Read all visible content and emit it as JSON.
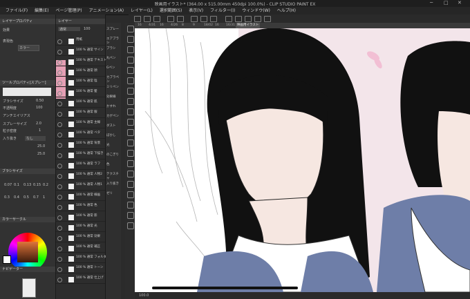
{
  "app": {
    "title": "映画用イラスト* (364.00 x 515.00mm 450dpi 100.0%) - CLIP STUDIO PAINT EX",
    "menu": [
      "ファイル(F)",
      "編集(E)",
      "ページ管理(P)",
      "アニメーション(A)",
      "レイヤー(L)",
      "選択範囲(S)",
      "表示(V)",
      "フィルター(I)",
      "ウィンドウ(W)",
      "ヘルプ(H)"
    ]
  },
  "left_panel": {
    "tool_property_title": "レイヤープロパティ",
    "effect_label": "効果",
    "expression_label": "表現色",
    "expression_value": "カラー",
    "brush_panel_title": "ツールプロパティ[スプレー]",
    "brush_size_label": "ブラシサイズ",
    "brush_size_value": "0.50",
    "opacity_label": "不透明度",
    "opacity_value": "100",
    "antialias_label": "アンチエイリアス",
    "spray_size_label": "スプレーサイズ",
    "spray_size_value": "2.0",
    "particle_density_label": "粒子密度",
    "particle_density_value": "1",
    "stroke_label": "入り抜き",
    "stroke_value": "なし",
    "stroke_a": "25.0",
    "stroke_b": "25.0",
    "brush_size_panel_title": "ブラシサイズ",
    "size_presets": [
      "0.07",
      "0.1",
      "0.13",
      "0.15",
      "0.2",
      "0.3",
      "0.4",
      "0.5",
      "0.7",
      "1"
    ],
    "color_panel_title": "カラーサークル",
    "navigator_title": "ナビゲーター"
  },
  "layer_panel": {
    "title": "レイヤー",
    "blend_mode": "通常",
    "opacity": "100",
    "layers": [
      {
        "name": "用紙"
      },
      {
        "name": "100 % 通常 サイン"
      },
      {
        "name": "100 % 通常 テキスト"
      },
      {
        "name": "100 % 通常 顔"
      },
      {
        "name": "100 % 通常 陰"
      },
      {
        "name": "100 % 通常 髪"
      },
      {
        "name": "100 % 通常 肌"
      },
      {
        "name": "100 % 通常 服"
      },
      {
        "name": "100 % 通常 主線"
      },
      {
        "name": "100 % 通常 ベタ"
      },
      {
        "name": "100 % 通常 背景"
      },
      {
        "name": "100 % 通常 下描き"
      },
      {
        "name": "100 % 通常 ラフ"
      },
      {
        "name": "100 % 通常 人物2"
      },
      {
        "name": "100 % 通常 人物1"
      },
      {
        "name": "100 % 通常 線画"
      },
      {
        "name": "100 % 通常 色"
      },
      {
        "name": "100 % 通常 影"
      },
      {
        "name": "100 % 通常 光"
      },
      {
        "name": "100 % 通常 効果"
      },
      {
        "name": "100 % 通常 補正"
      },
      {
        "name": "100 % 通常 フォルダー"
      },
      {
        "name": "100 % 通常 トーン"
      },
      {
        "name": "100 % 通常 仕上げ"
      }
    ]
  },
  "subtools": [
    "スプレー",
    "エアブラシ",
    "ブラシ",
    "丸ペン",
    "Gペン",
    "カブラペン",
    "ミリペン",
    "効果線",
    "かすれ",
    "カゲペン",
    "ダスト",
    "ぼかし",
    "光",
    "のこぎり",
    "色",
    "テクスチャ",
    "入り抜き",
    "ゼリ"
  ],
  "tabs": [
    "16",
    "4/31",
    "16",
    "4/26",
    "8",
    "9",
    "18/02",
    "16",
    "16/31",
    "映画用イラスト"
  ],
  "status": {
    "zoom": "100.0"
  },
  "colors": {
    "accent": "#3f77c9",
    "pink": "#e69fb5",
    "canvas": "#f3e5ea",
    "uniform": "#6e7ea8"
  }
}
